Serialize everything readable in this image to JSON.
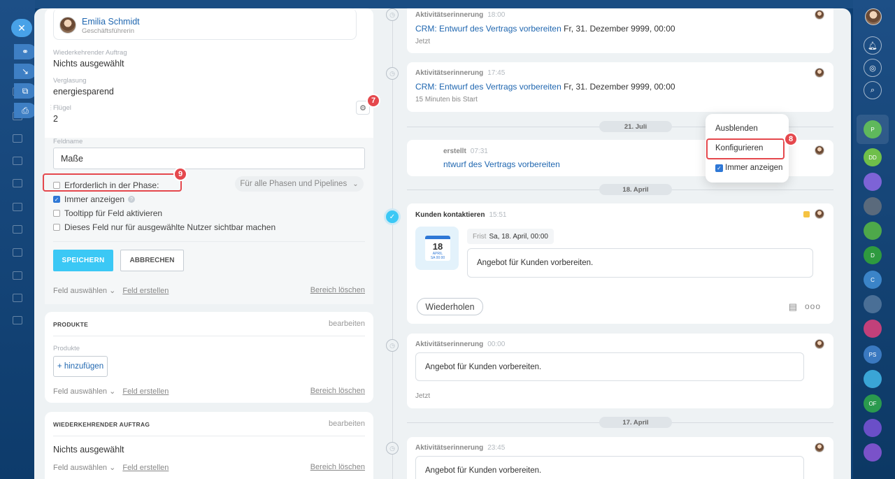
{
  "contact": {
    "name": "Emilia Schmidt",
    "role": "Geschäftsführerin"
  },
  "fields": [
    {
      "label": "Wiederkehrender Auftrag",
      "value": "Nichts ausgewählt"
    },
    {
      "label": "Verglasung",
      "value": "energiesparend"
    },
    {
      "label": "Flügel",
      "value": "2"
    }
  ],
  "editor": {
    "field_name_label": "Feldname",
    "field_name_value": "Maße",
    "checkboxes": [
      {
        "label": "Erforderlich in der Phase:",
        "checked": false
      },
      {
        "label": "Immer anzeigen",
        "checked": true
      },
      {
        "label": "Tooltipp für Feld aktivieren",
        "checked": false
      },
      {
        "label": "Dieses Feld nur für ausgewählte Nutzer sichtbar machen",
        "checked": false
      }
    ],
    "phase_select": "Für alle Phasen und Pipelines",
    "save": "SPEICHERN",
    "cancel": "ABBRECHEN"
  },
  "section_footer": {
    "select": "Feld auswählen",
    "create": "Feld erstellen",
    "delete": "Bereich löschen"
  },
  "products": {
    "title": "PRODUKTE",
    "edit": "bearbeiten",
    "label": "Produkte",
    "add": "+ hinzufügen"
  },
  "recurring": {
    "title": "WIEDERKEHRENDER AUFTRAG",
    "edit": "bearbeiten",
    "value": "Nichts ausgewählt"
  },
  "badges": [
    "7",
    "8",
    "9"
  ],
  "popup": {
    "items": [
      "Ausblenden",
      "Konfigurieren",
      "Immer anzeigen"
    ]
  },
  "timeline": {
    "item1": {
      "title": "Aktivitätserinnerung",
      "time": "18:00",
      "link": "CRM: Entwurf des Vertrags vorbereiten",
      "date": "Fr, 31. Dezember 9999, 00:00",
      "sub": "Jetzt"
    },
    "item2": {
      "title": "Aktivitätserinnerung",
      "time": "17:45",
      "link": "CRM: Entwurf des Vertrags vorbereiten",
      "date": "Fr, 31. Dezember 9999, 00:00",
      "sub": "15 Minuten bis Start"
    },
    "sep1": "21. Juli",
    "item3": {
      "title": "erstellt",
      "time": "07:31",
      "link": "ntwurf des Vertrags vorbereiten"
    },
    "sep2": "18. April",
    "item4": {
      "title": "Kunden kontaktieren",
      "time": "15:51",
      "cal_day": "18",
      "cal_month": "APRIL",
      "cal_sub": "SA 00:00",
      "frist_label": "Frist",
      "frist_value": "Sa, 18. April, 00:00",
      "text": "Angebot für Kunden vorbereiten.",
      "repeat": "Wiederholen"
    },
    "item5": {
      "title": "Aktivitätserinnerung",
      "time": "00:00",
      "text": "Angebot für Kunden vorbereiten.",
      "sub": "Jetzt"
    },
    "sep3": "17. April",
    "item6": {
      "title": "Aktivitätserinnerung",
      "time": "23:45",
      "text": "Angebot für Kunden vorbereiten."
    }
  },
  "right_bar": [
    "P",
    "DD",
    "D",
    "C",
    "PS",
    "OF"
  ],
  "colors": {
    "accent": "#3bc8f5",
    "badge": "#e5484d",
    "link": "#2067b0"
  }
}
